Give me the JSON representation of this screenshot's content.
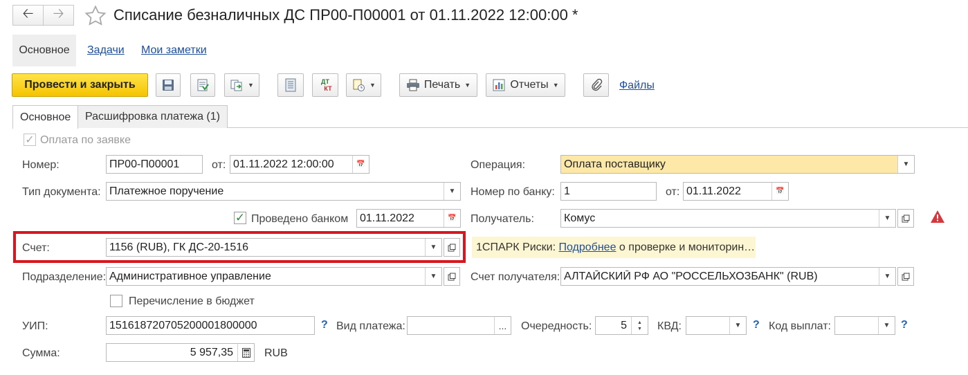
{
  "header": {
    "title": "Списание безналичных ДС ПР00-П00001 от 01.11.2022 12:00:00 *"
  },
  "subtabs": {
    "main": "Основное",
    "tasks": "Задачи",
    "notes": "Мои заметки"
  },
  "toolbar": {
    "post_close": "Провести и закрыть",
    "print": "Печать",
    "reports": "Отчеты",
    "files": "Файлы",
    "dtkt_top": "ДТ",
    "dtkt_bottom": "КТ"
  },
  "tabs": {
    "main": "Основное",
    "payment_breakdown": "Расшифровка платежа (1)"
  },
  "form": {
    "pay_by_request": {
      "label": "Оплата по заявке",
      "checked": true
    },
    "number": {
      "label": "Номер:",
      "value": "ПР00-П00001"
    },
    "from1": {
      "label": "от:",
      "value": "01.11.2022 12:00:00"
    },
    "operation": {
      "label": "Операция:",
      "value": "Оплата поставщику"
    },
    "doc_type": {
      "label": "Тип документа:",
      "value": "Платежное поручение"
    },
    "bank_number": {
      "label": "Номер по банку:",
      "value": "1"
    },
    "from2": {
      "label": "от:",
      "value": "01.11.2022"
    },
    "posted_by_bank": {
      "label": "Проведено банком",
      "checked": true,
      "date": "01.11.2022"
    },
    "recipient": {
      "label": "Получатель:",
      "value": "Комус"
    },
    "account": {
      "label": "Счет:",
      "value": "1156 (RUB), ГК ДС-20-1516"
    },
    "spark": {
      "prefix": "1СПАРК Риски: ",
      "link": "Подробнее",
      "suffix": " о проверке и мониторин…"
    },
    "department": {
      "label": "Подразделение:",
      "value": "Административное управление"
    },
    "recipient_account": {
      "label": "Счет получателя:",
      "value": "АЛТАЙСКИЙ РФ АО \"РОССЕЛЬХОЗБАНК\" (RUB)"
    },
    "budget_transfer": {
      "label": "Перечисление в бюджет",
      "checked": false
    },
    "uip": {
      "label": "УИП:",
      "value": "15161872070520000180000​0"
    },
    "payment_type": {
      "label": "Вид платежа:",
      "value": ""
    },
    "priority": {
      "label": "Очередность:",
      "value": "5"
    },
    "kvd": {
      "label": "КВД:",
      "value": ""
    },
    "payout_code": {
      "label": "Код выплат:",
      "value": ""
    },
    "amount": {
      "label": "Сумма:",
      "value": "5 957,35",
      "currency": "RUB"
    },
    "help": "?"
  },
  "colors": {
    "primary_button": "#f5c400",
    "highlight": "#d7161f",
    "operation_bg": "#fde8a8",
    "warning": "#d7363b",
    "link": "#1c4e9e"
  }
}
